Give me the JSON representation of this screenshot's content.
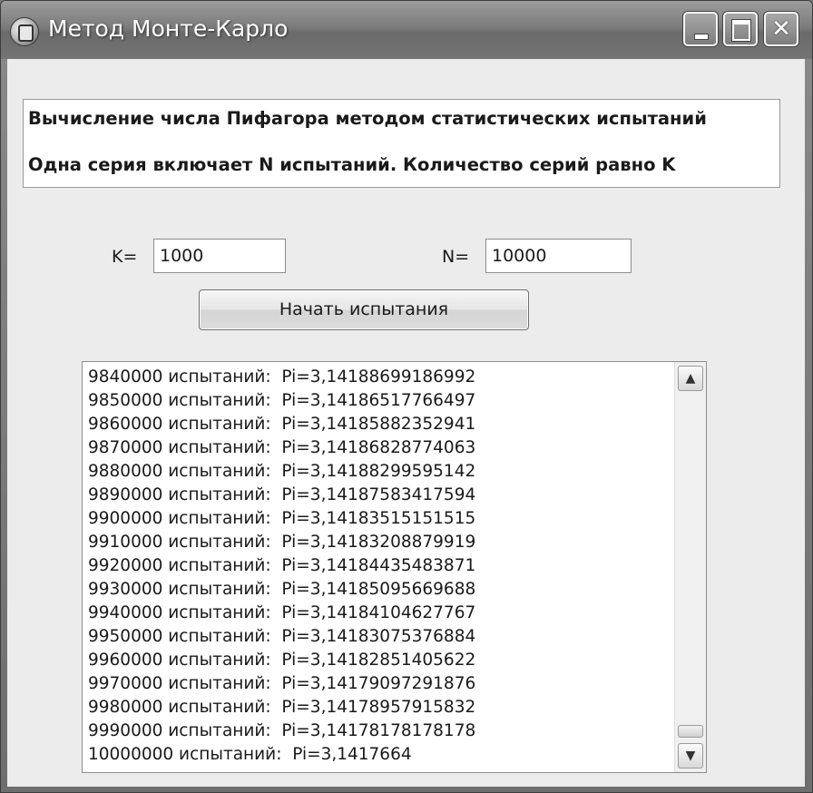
{
  "window": {
    "title": "Метод Монте-Карло",
    "close_glyph": "✕"
  },
  "info": {
    "line1": "Вычисление числа Пифагора методом статистических испытаний",
    "line2": "Одна серия включает N  испытаний.  Количество серий равно K"
  },
  "inputs": {
    "k_label": "K=",
    "k_value": "1000",
    "n_label": "N=",
    "n_value": "10000"
  },
  "start_button": {
    "label": "Начать испытания"
  },
  "results": {
    "items": [
      "9840000 испытаний:  Pi=3,14188699186992",
      "9850000 испытаний:  Pi=3,14186517766497",
      "9860000 испытаний:  Pi=3,14185882352941",
      "9870000 испытаний:  Pi=3,14186828774063",
      "9880000 испытаний:  Pi=3,14188299595142",
      "9890000 испытаний:  Pi=3,14187583417594",
      "9900000 испытаний:  Pi=3,14183515151515",
      "9910000 испытаний:  Pi=3,14183208879919",
      "9920000 испытаний:  Pi=3,14184435483871",
      "9930000 испытаний:  Pi=3,14185095669688",
      "9940000 испытаний:  Pi=3,14184104627767",
      "9950000 испытаний:  Pi=3,14183075376884",
      "9960000 испытаний:  Pi=3,14182851405622",
      "9970000 испытаний:  Pi=3,14179097291876",
      "9980000 испытаний:  Pi=3,14178957915832",
      "9990000 испытаний:  Pi=3,14178178178178",
      "10000000 испытаний:  Pi=3,1417664"
    ],
    "scroll_position": 1.0
  },
  "icons": {
    "app": "app-icon",
    "minimize": "minimize-icon",
    "maximize": "maximize-icon",
    "close": "close-icon",
    "scroll_up": "chevron-up-icon",
    "scroll_down": "chevron-down-icon"
  }
}
